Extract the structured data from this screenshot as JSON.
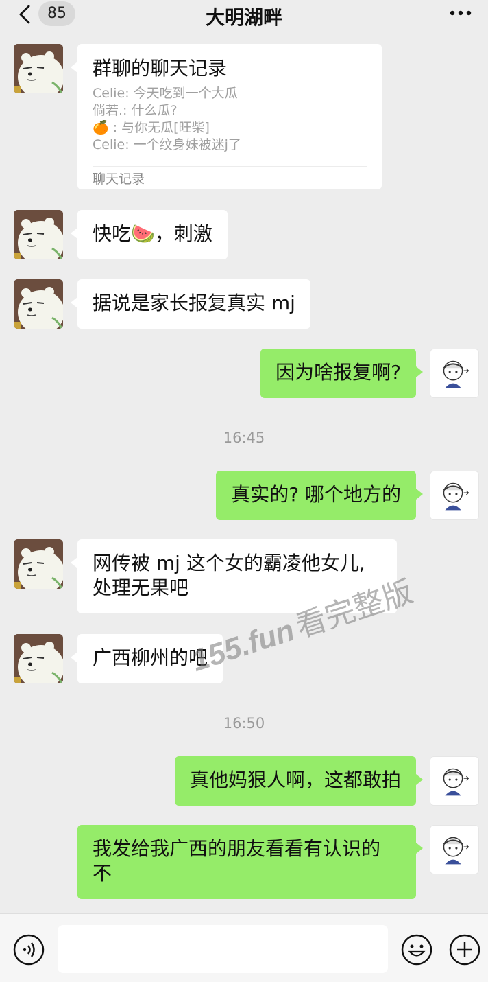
{
  "header": {
    "unread_count": "85",
    "title": "大明湖畔"
  },
  "record_card": {
    "title": "群聊的聊天记录",
    "lines": [
      "Celie: 今天吃到一个大瓜",
      "倘若.: 什么瓜?",
      "🍊 : 与你无瓜[旺柴]",
      "Celie: 一个纹身妹被迷j了"
    ],
    "footer": "聊天记录"
  },
  "messages": [
    {
      "text": "快吃🍉，刺激"
    },
    {
      "text": "据说是家长报复真实 mj"
    },
    {
      "text": "因为啥报复啊?"
    },
    {
      "text": "真实的? 哪个地方的"
    },
    {
      "text": "网传被 mj 这个女的霸凌他女儿,\n处理无果吧"
    },
    {
      "text": "广西柳州的吧"
    },
    {
      "text": "真他妈狠人啊，这都敢拍"
    },
    {
      "text": "我发给我广西的朋友看看有认识的\n不"
    }
  ],
  "timestamps": [
    "16:45",
    "16:50"
  ],
  "watermark": {
    "domain": "155.fun",
    "text": "看完整版"
  },
  "icons": {
    "back": "chevron-left-icon",
    "more": "more-dots-icon",
    "voice": "voice-icon",
    "emoji": "emoji-icon",
    "plus": "plus-icon"
  },
  "colors": {
    "background": "#ededed",
    "incoming_bubble": "#ffffff",
    "outgoing_bubble": "#95ec69"
  }
}
